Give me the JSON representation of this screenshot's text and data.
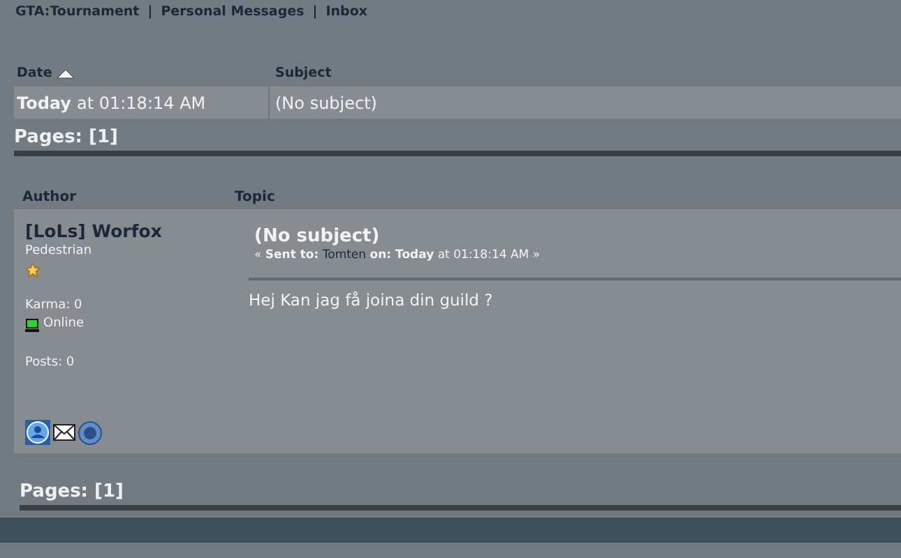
{
  "breadcrumb": [
    "GTA:Tournament",
    "Personal Messages",
    "Inbox"
  ],
  "separator": "|",
  "inbox": {
    "columns": [
      {
        "label": "Date",
        "sorted": true
      },
      {
        "label": "Subject",
        "sorted": false
      }
    ],
    "rows": [
      {
        "date_bold": "Today",
        "date_rest": "at 01:18:14 AM",
        "subject": "(No subject)"
      }
    ]
  },
  "pages_top": "Pages: [1]",
  "post_header": {
    "author": "Author",
    "topic": "Topic"
  },
  "post": {
    "author": "[LoLs] Worfox",
    "rank": "Pedestrian",
    "karma": "Karma: 0",
    "online": true,
    "status": "Online",
    "posts": "Posts: 0",
    "title": "(No subject)",
    "prev": "«",
    "sent_label": "Sent to:",
    "recipient": "Tomten",
    "on_label": "on:",
    "when_bold": "Today",
    "when": "at 01:18:14 AM",
    "next": "»",
    "body": "Hej Kan jag få joina din guild ?"
  },
  "pages_bottom": "Pages: [1]"
}
